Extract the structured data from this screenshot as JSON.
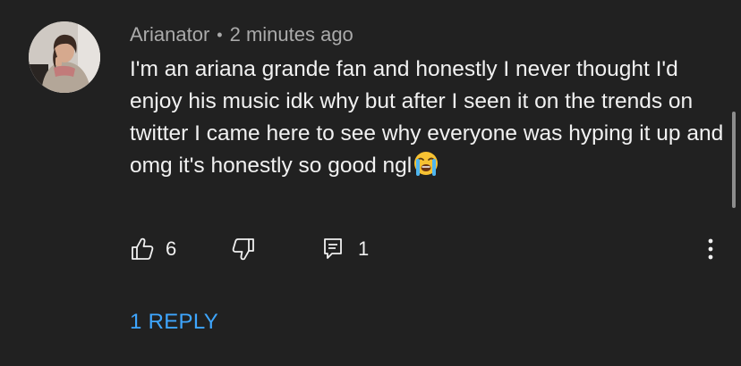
{
  "comment": {
    "author": "Arianator",
    "separator": "•",
    "time": "2 minutes ago",
    "text": "I'm an ariana grande fan and honestly I never thought I'd enjoy his music idk why but after I seen it on the trends on twitter I came here to see why everyone was hyping it up and omg it's honestly so good ngl",
    "emoji": "loudly-crying-face",
    "likes": "6",
    "replies_count": "1",
    "replies_link": "1 REPLY"
  },
  "icons": {
    "like": "thumbs-up-icon",
    "dislike": "thumbs-down-icon",
    "reply": "comment-icon",
    "menu": "more-vert-icon"
  },
  "colors": {
    "background": "#212121",
    "text": "#f1f1f1",
    "meta_text": "#aaaaaa",
    "link": "#3ea6ff"
  }
}
